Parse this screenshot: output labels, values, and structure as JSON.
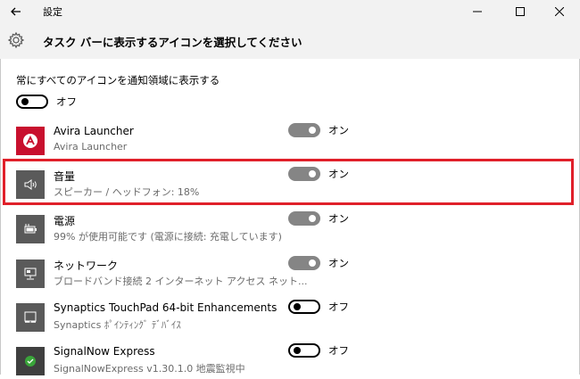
{
  "window": {
    "app_title": "設定",
    "page_title": "タスク バーに表示するアイコンを選択してください"
  },
  "always_show": {
    "label": "常にすべてのアイコンを通知領域に表示する",
    "state": "オフ"
  },
  "apps": [
    {
      "name": "Avira Launcher",
      "subtitle": "Avira Launcher",
      "state": "オン",
      "icon": "avira-icon"
    },
    {
      "name": "音量",
      "subtitle": "スピーカー / ヘッドフォン: 18%",
      "state": "オン",
      "icon": "volume-icon",
      "highlighted": true
    },
    {
      "name": "電源",
      "subtitle": "99% が使用可能です (電源に接続: 充電しています)",
      "state": "オン",
      "icon": "battery-icon"
    },
    {
      "name": "ネットワーク",
      "subtitle": "ブロードバンド接続 2 インターネット アクセス ネット...",
      "state": "オン",
      "icon": "network-icon"
    },
    {
      "name": "Synaptics TouchPad 64-bit Enhancements",
      "subtitle": "Synaptics ﾎﾟｲﾝﾃｨﾝｸﾞ ﾃﾞﾊﾞｲｽ",
      "state": "オフ",
      "icon": "touchpad-icon"
    },
    {
      "name": "SignalNow Express",
      "subtitle": "SignalNowExpress v1.30.1.0 地震監視中",
      "state": "オフ",
      "icon": "signalnow-icon"
    }
  ],
  "colors": {
    "header_bg": "#f2f2f2",
    "toggle_on": "#858585",
    "highlight": "#e0202a",
    "avira_red": "#c8102e"
  }
}
